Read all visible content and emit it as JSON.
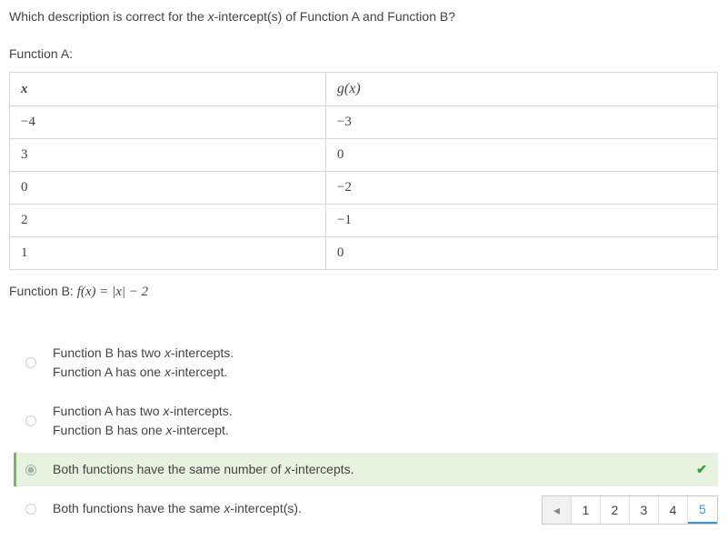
{
  "question": {
    "prefix": "Which description is correct for the ",
    "xvar": "x",
    "suffix": "-intercept(s) of Function A and Function B?"
  },
  "functionA_label": "Function A:",
  "table": {
    "header_x": "x",
    "header_gx": "g(x)",
    "rows": [
      {
        "x": "−4",
        "gx": "−3"
      },
      {
        "x": "3",
        "gx": "0"
      },
      {
        "x": "0",
        "gx": "−2"
      },
      {
        "x": "2",
        "gx": "−1"
      },
      {
        "x": "1",
        "gx": "0"
      }
    ]
  },
  "functionB_label": "Function B: ",
  "functionB_expr": "f(x) = |x| − 2",
  "options": [
    {
      "line1_pre": "Function B has two ",
      "line1_post": "-intercepts.",
      "line2_pre": "Function A has one ",
      "line2_post": "-intercept.",
      "xvar": "x",
      "selected": false,
      "twoLine": true
    },
    {
      "line1_pre": "Function A has two ",
      "line1_post": "-intercepts.",
      "line2_pre": "Function B has one ",
      "line2_post": "-intercept.",
      "xvar": "x",
      "selected": false,
      "twoLine": true
    },
    {
      "line1_pre": "Both functions have the same number of ",
      "line1_post": "-intercepts.",
      "xvar": "x",
      "selected": true,
      "twoLine": false
    },
    {
      "line1_pre": "Both functions have the same ",
      "line1_post": "-intercept(s).",
      "xvar": "x",
      "selected": false,
      "twoLine": false
    }
  ],
  "pagination": {
    "prev": "◂",
    "pages": [
      "1",
      "2",
      "3",
      "4",
      "5"
    ],
    "active": "5"
  },
  "check_icon": "✔"
}
